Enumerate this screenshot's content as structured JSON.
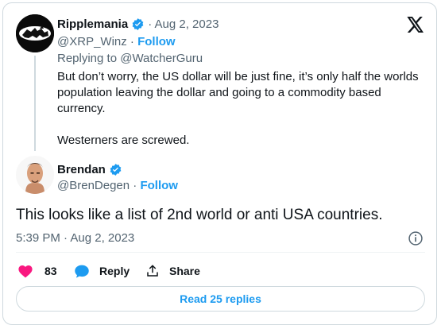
{
  "embed": {
    "logo_icon": "x-logo-icon"
  },
  "quoted": {
    "display_name": "Ripplemania",
    "verified": true,
    "date": "· Aug 2, 2023",
    "handle": "@XRP_Winz",
    "separator": " · ",
    "follow_label": "Follow",
    "replying_prefix": "Replying to ",
    "replying_to": "@WatcherGuru",
    "text_line1": "But don’t worry, the US dollar will be just fine, it’s only half the worlds",
    "text_line2": "population leaving the dollar and going to a commodity based",
    "text_line3": "currency.",
    "text_line4": "Westerners are screwed."
  },
  "reply": {
    "display_name": "Brendan",
    "verified": true,
    "handle": "@BrenDegen",
    "separator": " · ",
    "follow_label": "Follow",
    "text": "This looks like a list of 2nd world or anti USA countries.",
    "timestamp": "5:39 PM · Aug 2, 2023"
  },
  "actions": {
    "like_count": "83",
    "reply_label": "Reply",
    "share_label": "Share"
  },
  "footer": {
    "read_replies_label": "Read 25 replies"
  },
  "colors": {
    "accent": "#1d9bf0",
    "like": "#f91880",
    "muted": "#536471",
    "border": "#cfd9de"
  }
}
